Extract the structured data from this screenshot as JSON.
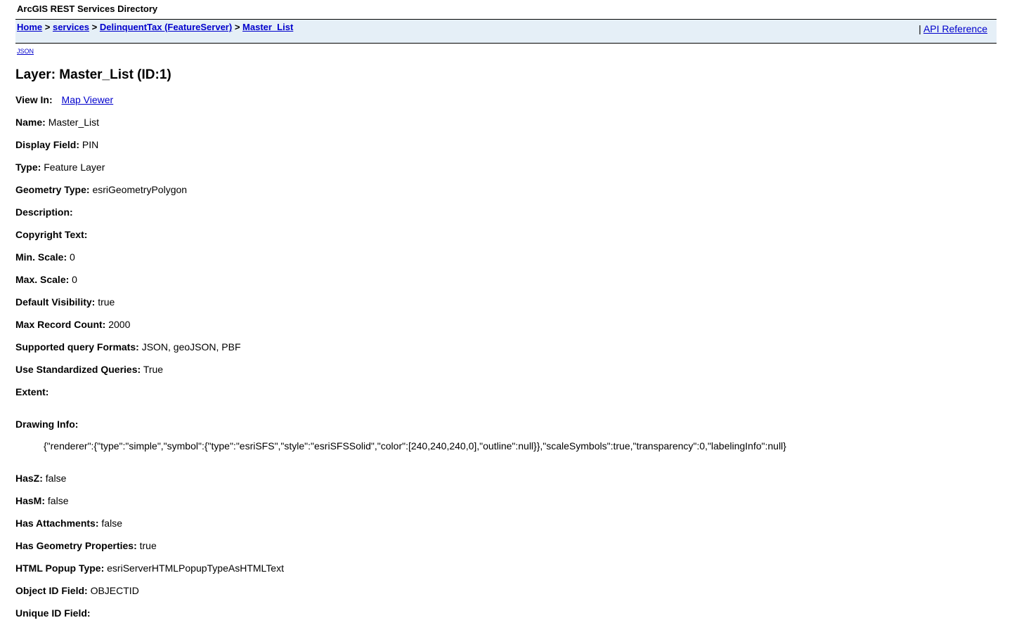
{
  "header": {
    "title": "ArcGIS REST Services Directory"
  },
  "nav": {
    "breadcrumbs": [
      "Home",
      "services",
      "DelinquentTax (FeatureServer)",
      "Master_List"
    ],
    "separator": ">",
    "api_sep": "|",
    "api_reference": "API Reference"
  },
  "formats": {
    "json": "JSON"
  },
  "layer": {
    "heading": "Layer: Master_List (ID:1)",
    "view_in_label": "View In:",
    "view_in_link": "Map Viewer",
    "fields": [
      {
        "label": "Name:",
        "value": "Master_List"
      },
      {
        "label": "Display Field:",
        "value": "PIN"
      },
      {
        "label": "Type:",
        "value": "Feature Layer"
      },
      {
        "label": "Geometry Type:",
        "value": "esriGeometryPolygon"
      },
      {
        "label": "Description:",
        "value": ""
      },
      {
        "label": "Copyright Text:",
        "value": ""
      },
      {
        "label": "Min. Scale:",
        "value": "0"
      },
      {
        "label": "Max. Scale:",
        "value": "0"
      },
      {
        "label": "Default Visibility:",
        "value": "true"
      },
      {
        "label": "Max Record Count:",
        "value": "2000"
      },
      {
        "label": "Supported query Formats:",
        "value": "JSON, geoJSON, PBF"
      },
      {
        "label": "Use Standardized Queries:",
        "value": "True"
      },
      {
        "label": "Extent:",
        "value": ""
      }
    ],
    "drawing_info_label": "Drawing Info:",
    "drawing_info_value": "{\"renderer\":{\"type\":\"simple\",\"symbol\":{\"type\":\"esriSFS\",\"style\":\"esriSFSSolid\",\"color\":[240,240,240,0],\"outline\":null}},\"scaleSymbols\":true,\"transparency\":0,\"labelingInfo\":null}",
    "fields2": [
      {
        "label": "HasZ:",
        "value": "false"
      },
      {
        "label": "HasM:",
        "value": "false"
      },
      {
        "label": "Has Attachments:",
        "value": "false"
      },
      {
        "label": "Has Geometry Properties:",
        "value": "true"
      },
      {
        "label": "HTML Popup Type:",
        "value": "esriServerHTMLPopupTypeAsHTMLText"
      },
      {
        "label": "Object ID Field:",
        "value": "OBJECTID"
      },
      {
        "label": "Unique ID Field:",
        "value": ""
      }
    ]
  }
}
